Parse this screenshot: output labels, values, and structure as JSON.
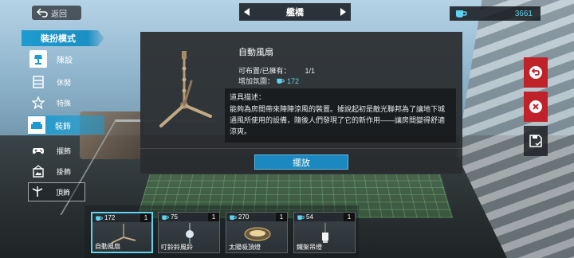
{
  "top_bar": {
    "back_label": "返回",
    "nav_title": "艦橋",
    "currency_amount": "3661"
  },
  "sidebar": {
    "mode_title": "裝扮模式",
    "categories": [
      {
        "label": "陳設",
        "icon": "lamp-icon"
      },
      {
        "label": "休閒",
        "icon": "bookshelf-icon"
      },
      {
        "label": "特殊",
        "icon": "star-icon"
      },
      {
        "label": "裝飾",
        "icon": "sofa-icon"
      },
      {
        "label": "擺飾",
        "icon": "gamepad-icon"
      },
      {
        "label": "掛飾",
        "icon": "picture-frame-icon"
      },
      {
        "label": "頂飾",
        "icon": "ceiling-fan-icon"
      }
    ]
  },
  "detail": {
    "name": "自動風扇",
    "owned_label": "可布置/已擁有：",
    "owned_value": "1/1",
    "comfort_label": "增加氛圍：",
    "comfort_value": "172",
    "desc_title": "道具描述：",
    "desc_text": "能夠為房間帶來陣陣涼風的裝置。據說起初是敵光聯邦為了讓地下城通風所使用的設備，隨後人們發現了它的新作用——讓房間變得舒適涼爽。",
    "place_button": "擺放"
  },
  "inventory": [
    {
      "name": "自動風扇",
      "comfort": "172",
      "count": "1"
    },
    {
      "name": "叮鈴鈴風鈴",
      "comfort": "75",
      "count": "1"
    },
    {
      "name": "太陽吸頂燈",
      "comfort": "270",
      "count": "1"
    },
    {
      "name": "鐵架吊燈",
      "comfort": "54",
      "count": "1"
    }
  ],
  "colors": {
    "accent_blue": "#1d9bd0",
    "comfort_blue": "#5fd3f0",
    "danger_red": "#c0222a"
  }
}
